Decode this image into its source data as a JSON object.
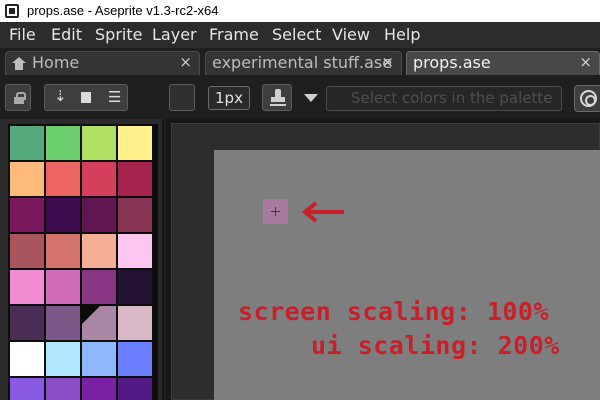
{
  "window": {
    "title": "props.ase - Aseprite v1.3-rc2-x64"
  },
  "menu": [
    "File",
    "Edit",
    "Sprite",
    "Layer",
    "Frame",
    "Select",
    "View",
    "Help"
  ],
  "tabs": [
    {
      "label": "Home",
      "icon": "home-icon",
      "close": "×"
    },
    {
      "label": "experimental stuff.ase",
      "close": "×"
    },
    {
      "label": "props.ase",
      "close": "×",
      "active": true
    }
  ],
  "contextbar": {
    "brush_size": "1px",
    "palette_search_placeholder": "Select colors in the palette",
    "icons": [
      "lock-icon",
      "arrow-down-icon",
      "page-icon",
      "menu-icon",
      "stamp-icon",
      "chevron-down-icon",
      "quit-icon"
    ]
  },
  "palette": {
    "columns": 4,
    "selected_index": 22,
    "colors": [
      "#56a97a",
      "#6acf6c",
      "#afdf63",
      "#fff08b",
      "#fdba7b",
      "#ec6563",
      "#d43f5b",
      "#a4224b",
      "#7a185c",
      "#3e0b4e",
      "#611652",
      "#883353",
      "#a9555d",
      "#d5746e",
      "#f5ae96",
      "#fdc6f1",
      "#f08ccf",
      "#d06cba",
      "#883683",
      "#241234",
      "#4a2d55",
      "#7b5787",
      "#ab87a6",
      "#d9b8c7",
      "#ffffff",
      "#b1e7fe",
      "#8eb7fc",
      "#6b7ffd",
      "#8a5ae3",
      "#8c4ec6",
      "#7b21a5",
      "#521a84"
    ]
  },
  "canvas": {
    "background": "#7e7e7e",
    "sprite_color": "#a77a9e",
    "annotation_color": "#c8202a",
    "annotation_line1": "screen scaling: 100%",
    "annotation_line2": "ui scaling: 200%"
  }
}
